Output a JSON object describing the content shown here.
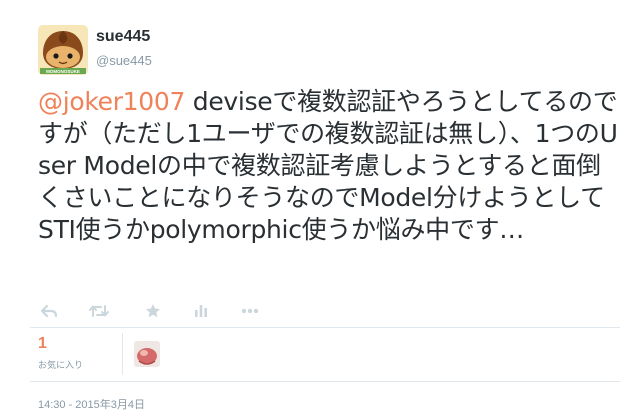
{
  "author": {
    "name": "sue445",
    "handle": "@sue445",
    "avatar_icon": "chestnut-mascot-icon",
    "avatar_caption": "MOMONOSUKE"
  },
  "tweet": {
    "mention": "@joker1007",
    "body": " deviseで複数認証やろうとしてるのですが（ただし1ユーザでの複数認証は無し）、1つのUser Modelの中で複数認証考慮しようとすると面倒くさいことになりそうなのでModel分けようとしてSTI使うかpolymorphic使うか悩み中です…"
  },
  "actions": [
    {
      "name": "reply-icon"
    },
    {
      "name": "retweet-icon"
    },
    {
      "name": "favorite-star-icon"
    },
    {
      "name": "stats-bar-icon"
    },
    {
      "name": "more-dots-icon"
    }
  ],
  "stats": {
    "favorites_count": "1",
    "favorites_label": "お気に入り"
  },
  "timestamp": "14:30 - 2015年3月4日",
  "colors": {
    "accent": "#f0825a",
    "muted": "#8899a6",
    "text": "#292f33",
    "divider": "#e1e8ed"
  }
}
